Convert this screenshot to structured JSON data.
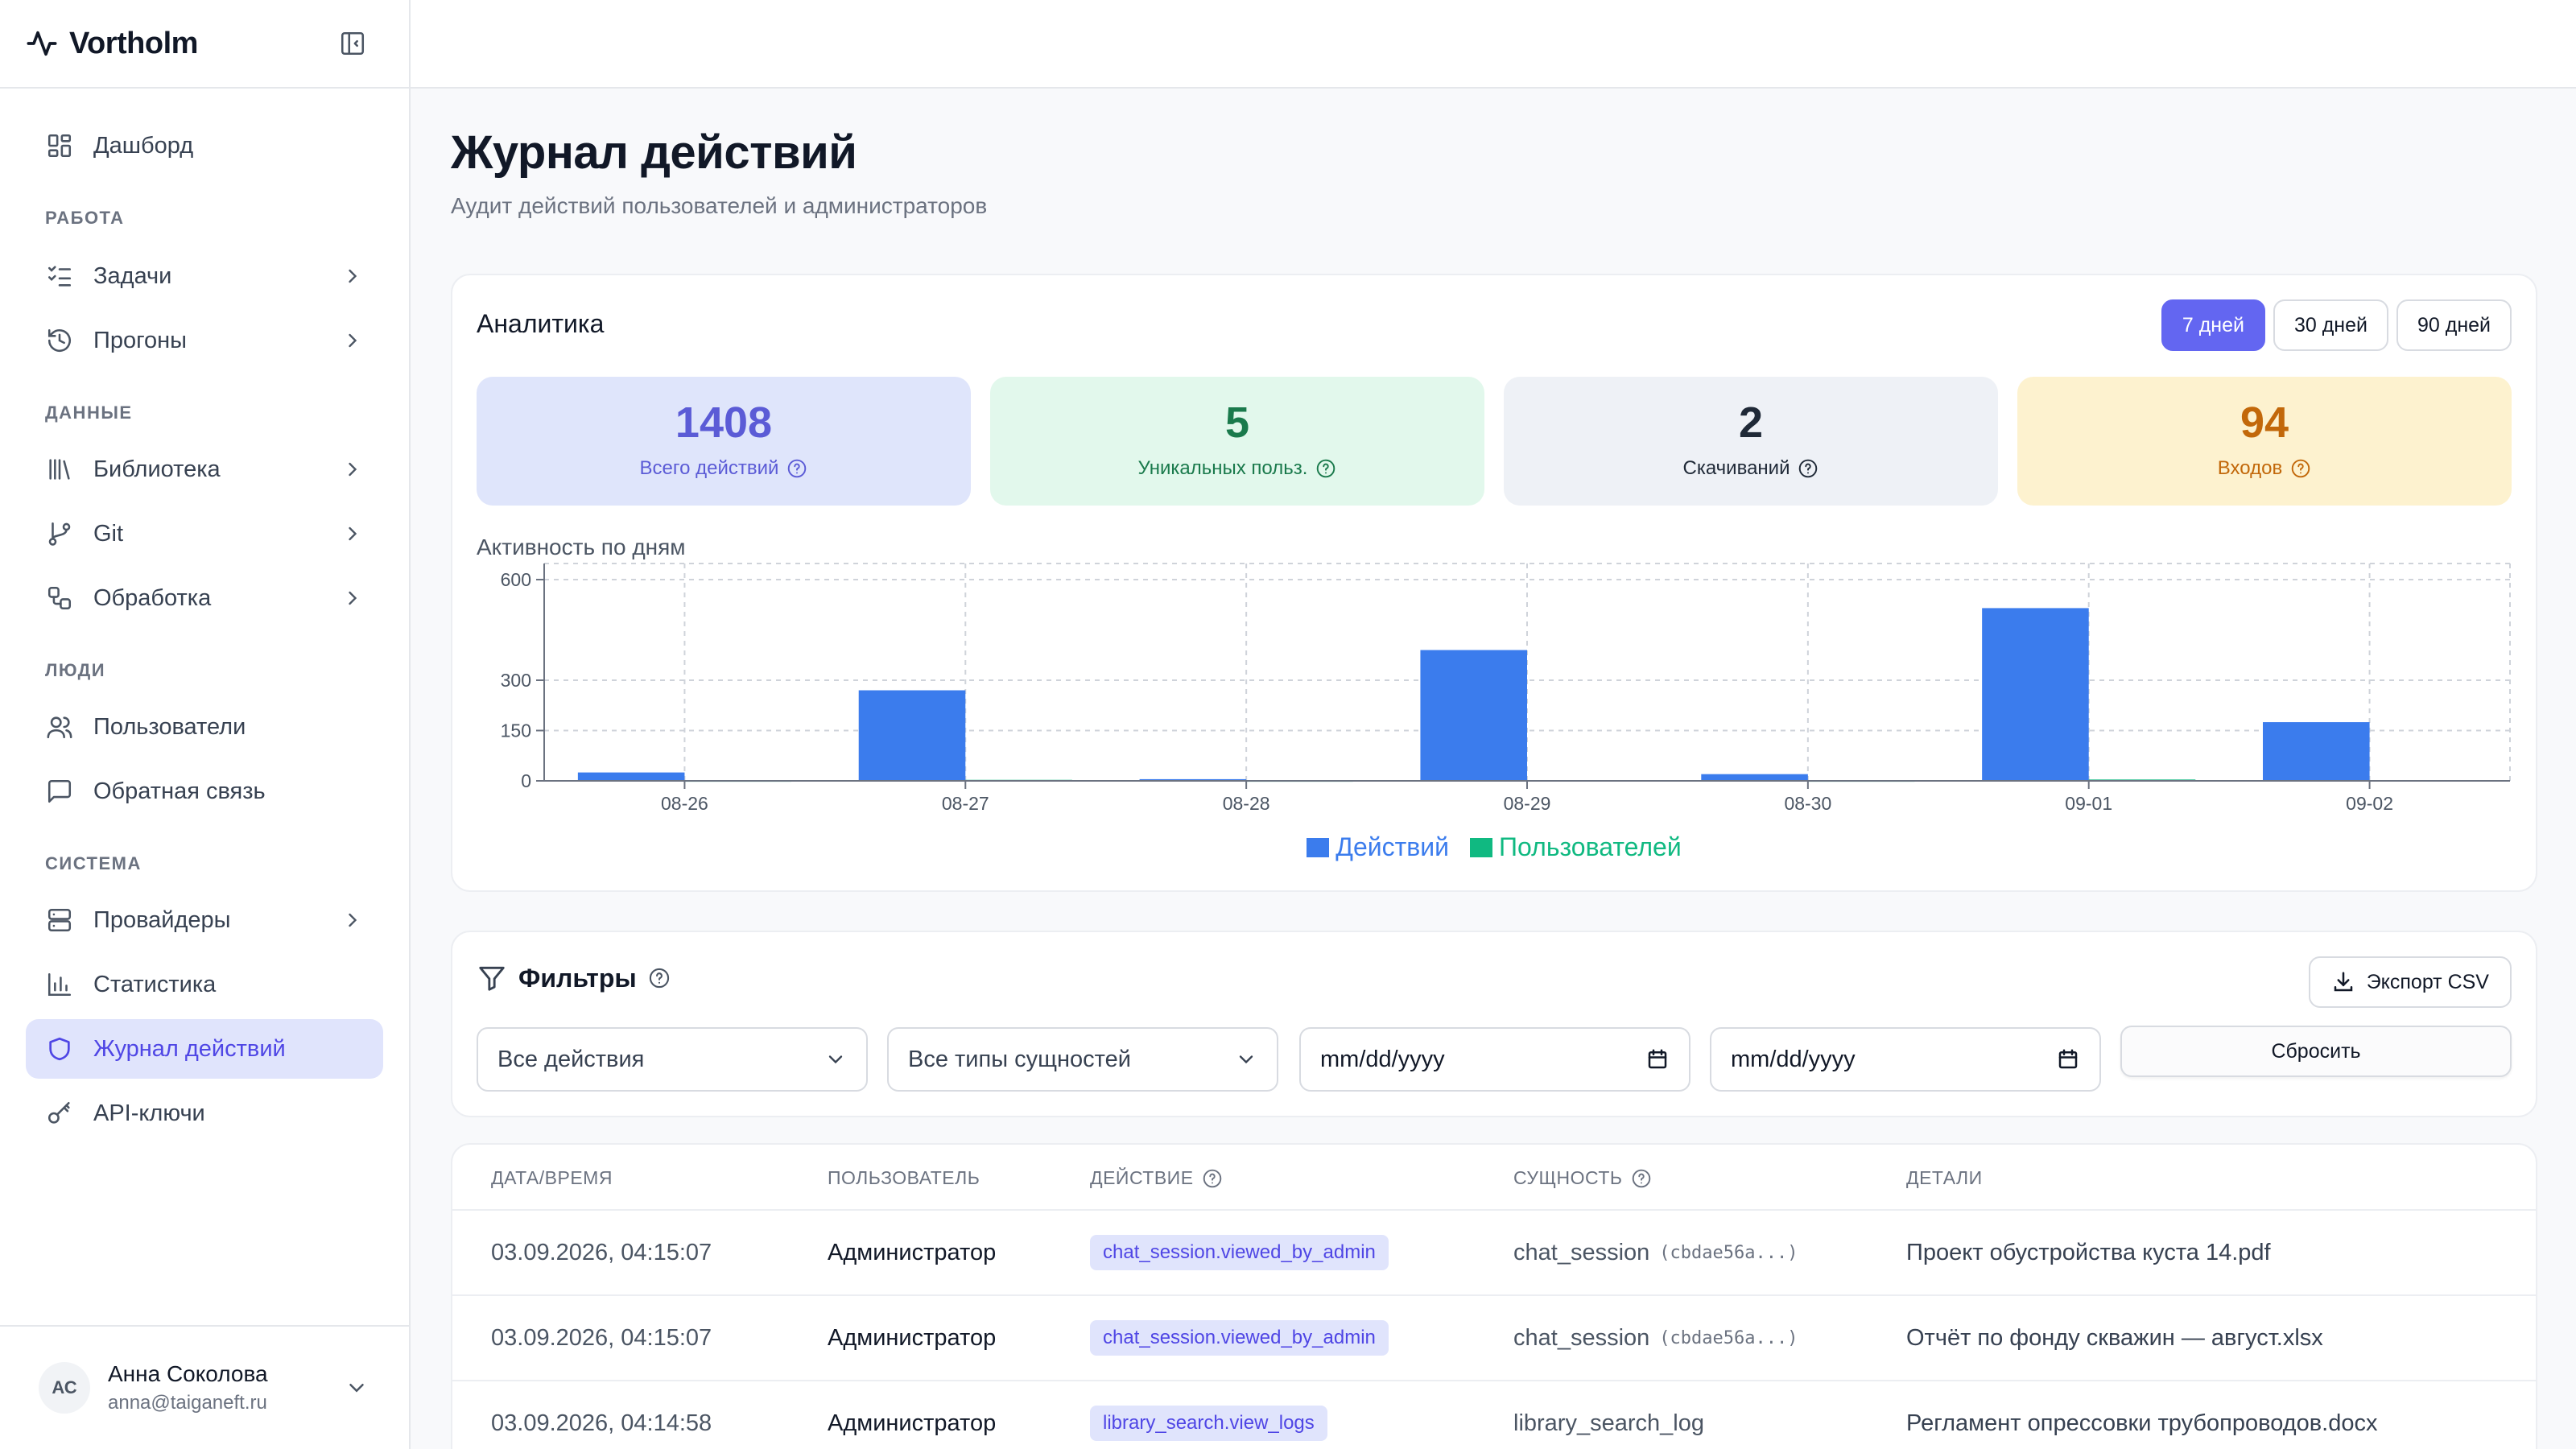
{
  "brand": {
    "name": "Vortholm"
  },
  "sidebar": {
    "items": [
      {
        "label": "Дашборд"
      },
      {
        "label": "Задачи"
      },
      {
        "label": "Прогоны"
      },
      {
        "label": "Библиотека"
      },
      {
        "label": "Git"
      },
      {
        "label": "Обработка"
      },
      {
        "label": "Пользователи"
      },
      {
        "label": "Обратная связь"
      },
      {
        "label": "Провайдеры"
      },
      {
        "label": "Статистика"
      },
      {
        "label": "Журнал действий"
      },
      {
        "label": "API-ключи"
      }
    ],
    "sections": [
      "РАБОТА",
      "ДАННЫЕ",
      "ЛЮДИ",
      "СИСТЕМА"
    ],
    "active_index": 10
  },
  "user": {
    "initials": "АС",
    "name": "Анна Соколова",
    "email": "anna@taiganeft.ru"
  },
  "page": {
    "title": "Журнал действий",
    "subtitle": "Аудит действий пользователей и администраторов"
  },
  "analytics": {
    "title": "Аналитика",
    "periods": [
      "7 дней",
      "30 дней",
      "90 дней"
    ],
    "active_period": 0,
    "stats": [
      {
        "value": "1408",
        "label": "Всего действий",
        "bg": "#dfe5fb",
        "color": "#5b5bd6"
      },
      {
        "value": "5",
        "label": "Уникальных польз.",
        "bg": "#e2f8ec",
        "color": "#1a7a4c"
      },
      {
        "value": "2",
        "label": "Скачиваний",
        "bg": "#eef1f6",
        "color": "#1f2937"
      },
      {
        "value": "94",
        "label": "Входов",
        "bg": "#fdf2cf",
        "color": "#c2680a"
      }
    ]
  },
  "chart_data": {
    "type": "bar",
    "title": "Активность по дням",
    "categories": [
      "08-26",
      "08-27",
      "08-28",
      "08-29",
      "08-30",
      "09-01",
      "09-02"
    ],
    "series": [
      {
        "name": "Действий",
        "color": "#3b7ced",
        "values": [
          25,
          270,
          5,
          390,
          20,
          515,
          175
        ]
      },
      {
        "name": "Пользователей",
        "color": "#10b981",
        "values": [
          1,
          3,
          1,
          2,
          1,
          4,
          2
        ]
      }
    ],
    "ylim": [
      0,
      600
    ],
    "yticks": [
      0,
      150,
      300,
      600
    ],
    "grid": true,
    "legend": "bottom"
  },
  "filters": {
    "title": "Фильтры",
    "export_label": "Экспорт CSV",
    "action_select": "Все действия",
    "entity_select": "Все типы сущностей",
    "date_from": "mm/dd/yyyy",
    "date_to": "mm/dd/yyyy",
    "reset_label": "Сбросить"
  },
  "table": {
    "columns": [
      "ДАТА/ВРЕМЯ",
      "ПОЛЬЗОВАТЕЛЬ",
      "ДЕЙСТВИЕ",
      "СУЩНОСТЬ",
      "ДЕТАЛИ"
    ],
    "rows": [
      {
        "datetime": "03.09.2026, 04:15:07",
        "user": "Администратор",
        "action": "chat_session.viewed_by_admin",
        "entity": "chat_session",
        "entity_id": "(cbdae56a...)",
        "details": "Проект обустройства куста 14.pdf"
      },
      {
        "datetime": "03.09.2026, 04:15:07",
        "user": "Администратор",
        "action": "chat_session.viewed_by_admin",
        "entity": "chat_session",
        "entity_id": "(cbdae56a...)",
        "details": "Отчёт по фонду скважин — август.xlsx"
      },
      {
        "datetime": "03.09.2026, 04:14:58",
        "user": "Администратор",
        "action": "library_search.view_logs",
        "entity": "library_search_log",
        "entity_id": "",
        "details": "Регламент опрессовки трубопроводов.docx"
      }
    ]
  }
}
